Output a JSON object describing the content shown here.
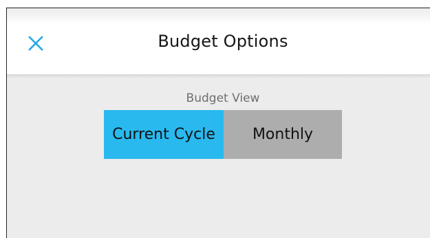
{
  "header": {
    "title": "Budget Options",
    "close_icon": "close-icon"
  },
  "budget_view": {
    "label": "Budget View",
    "options": [
      {
        "label": "Current Cycle",
        "selected": true
      },
      {
        "label": "Monthly",
        "selected": false
      }
    ]
  },
  "colors": {
    "accent": "#29b9ef",
    "segment_unselected": "#adadad",
    "content_background": "#ececec",
    "header_background": "#ffffff"
  }
}
